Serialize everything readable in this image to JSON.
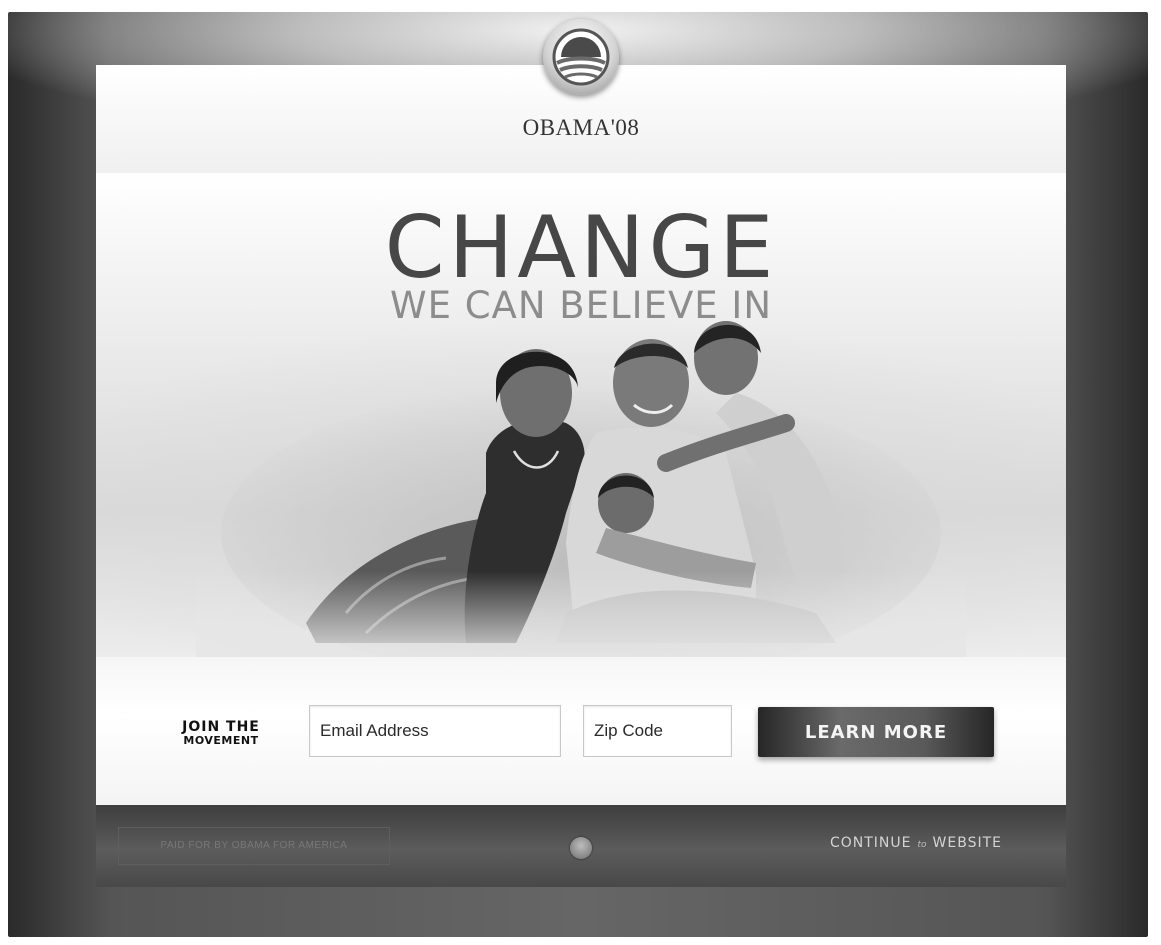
{
  "header": {
    "brand": "OBAMA'08"
  },
  "hero": {
    "headline": "CHANGE",
    "subheadline": "WE CAN BELIEVE IN"
  },
  "signup": {
    "label_line1": "JOIN THE",
    "label_line2": "MOVEMENT",
    "email_placeholder": "Email Address",
    "zip_placeholder": "Zip Code",
    "button_label": "LEARN MORE"
  },
  "footer": {
    "paid_for": "PAID FOR BY OBAMA FOR AMERICA",
    "continue_word": "CONTINUE",
    "to_word": "to",
    "website_word": "WEBSITE"
  },
  "icons": {
    "logo": "campaign-sunrise-logo",
    "footer_seal": "campaign-seal-icon"
  },
  "colors": {
    "palette": "grayscale",
    "button": "#4a4a4a",
    "headline": "#474747",
    "subheadline": "#8c8c8c"
  }
}
